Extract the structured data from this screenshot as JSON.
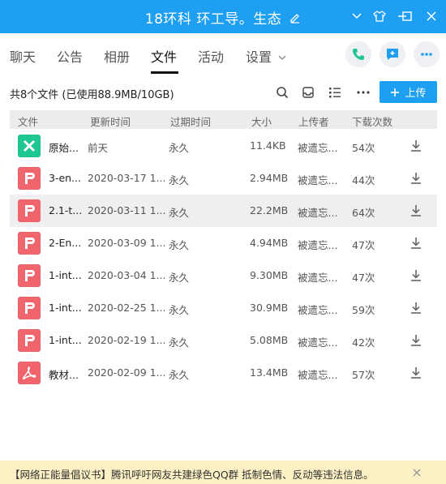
{
  "window": {
    "title": "18环科 环工导。生态",
    "controls": [
      "chevron-down",
      "shirt",
      "minimize",
      "maximize",
      "close"
    ]
  },
  "tabs": [
    {
      "label": "聊天",
      "active": false
    },
    {
      "label": "公告",
      "active": false
    },
    {
      "label": "相册",
      "active": false
    },
    {
      "label": "文件",
      "active": true
    },
    {
      "label": "活动",
      "active": false
    },
    {
      "label": "设置",
      "active": false
    }
  ],
  "toolbar": {
    "file_count": "共8个文件 (已使用88.9MB/10GB)",
    "upload_label": "上传"
  },
  "table": {
    "headers": {
      "name": "文件",
      "updated": "更新时间",
      "expire": "过期时间",
      "size": "大小",
      "uploader": "上传者",
      "downloads": "下载次数"
    },
    "rows": [
      {
        "type": "excel",
        "name": "原始...",
        "updated": "前天",
        "expire": "永久",
        "size": "11.4KB",
        "uploader": "被遗忘...",
        "downloads": "54次"
      },
      {
        "type": "ppt",
        "name": "3-en...",
        "updated": "2020-03-17 1...",
        "expire": "永久",
        "size": "2.94MB",
        "uploader": "被遗忘...",
        "downloads": "44次"
      },
      {
        "type": "ppt",
        "name": "2.1-t...",
        "updated": "2020-03-11 1...",
        "expire": "永久",
        "size": "22.2MB",
        "uploader": "被遗忘...",
        "downloads": "64次"
      },
      {
        "type": "ppt",
        "name": "2-En...",
        "updated": "2020-03-09 1...",
        "expire": "永久",
        "size": "4.94MB",
        "uploader": "被遗忘...",
        "downloads": "47次"
      },
      {
        "type": "ppt",
        "name": "1-int...",
        "updated": "2020-03-04 1...",
        "expire": "永久",
        "size": "9.30MB",
        "uploader": "被遗忘...",
        "downloads": "47次"
      },
      {
        "type": "ppt",
        "name": "1-int...",
        "updated": "2020-02-25 1...",
        "expire": "永久",
        "size": "30.9MB",
        "uploader": "被遗忘...",
        "downloads": "59次"
      },
      {
        "type": "ppt",
        "name": "1-int...",
        "updated": "2020-02-19 1...",
        "expire": "永久",
        "size": "5.08MB",
        "uploader": "被遗忘...",
        "downloads": "42次"
      },
      {
        "type": "pdf",
        "name": "教材...",
        "updated": "2020-02-09 1...",
        "expire": "永久",
        "size": "13.4MB",
        "uploader": "被遗忘...",
        "downloads": "57次"
      }
    ]
  },
  "notice": {
    "text": "【网络正能量倡议书】腾讯呼吁网友共建绿色QQ群 抵制色情、反动等违法信息。"
  },
  "colors": {
    "accent": "#1f9ff1",
    "excel": "#1fc592",
    "ppt": "#f0646c",
    "notice_bg": "#fdf0c4"
  }
}
